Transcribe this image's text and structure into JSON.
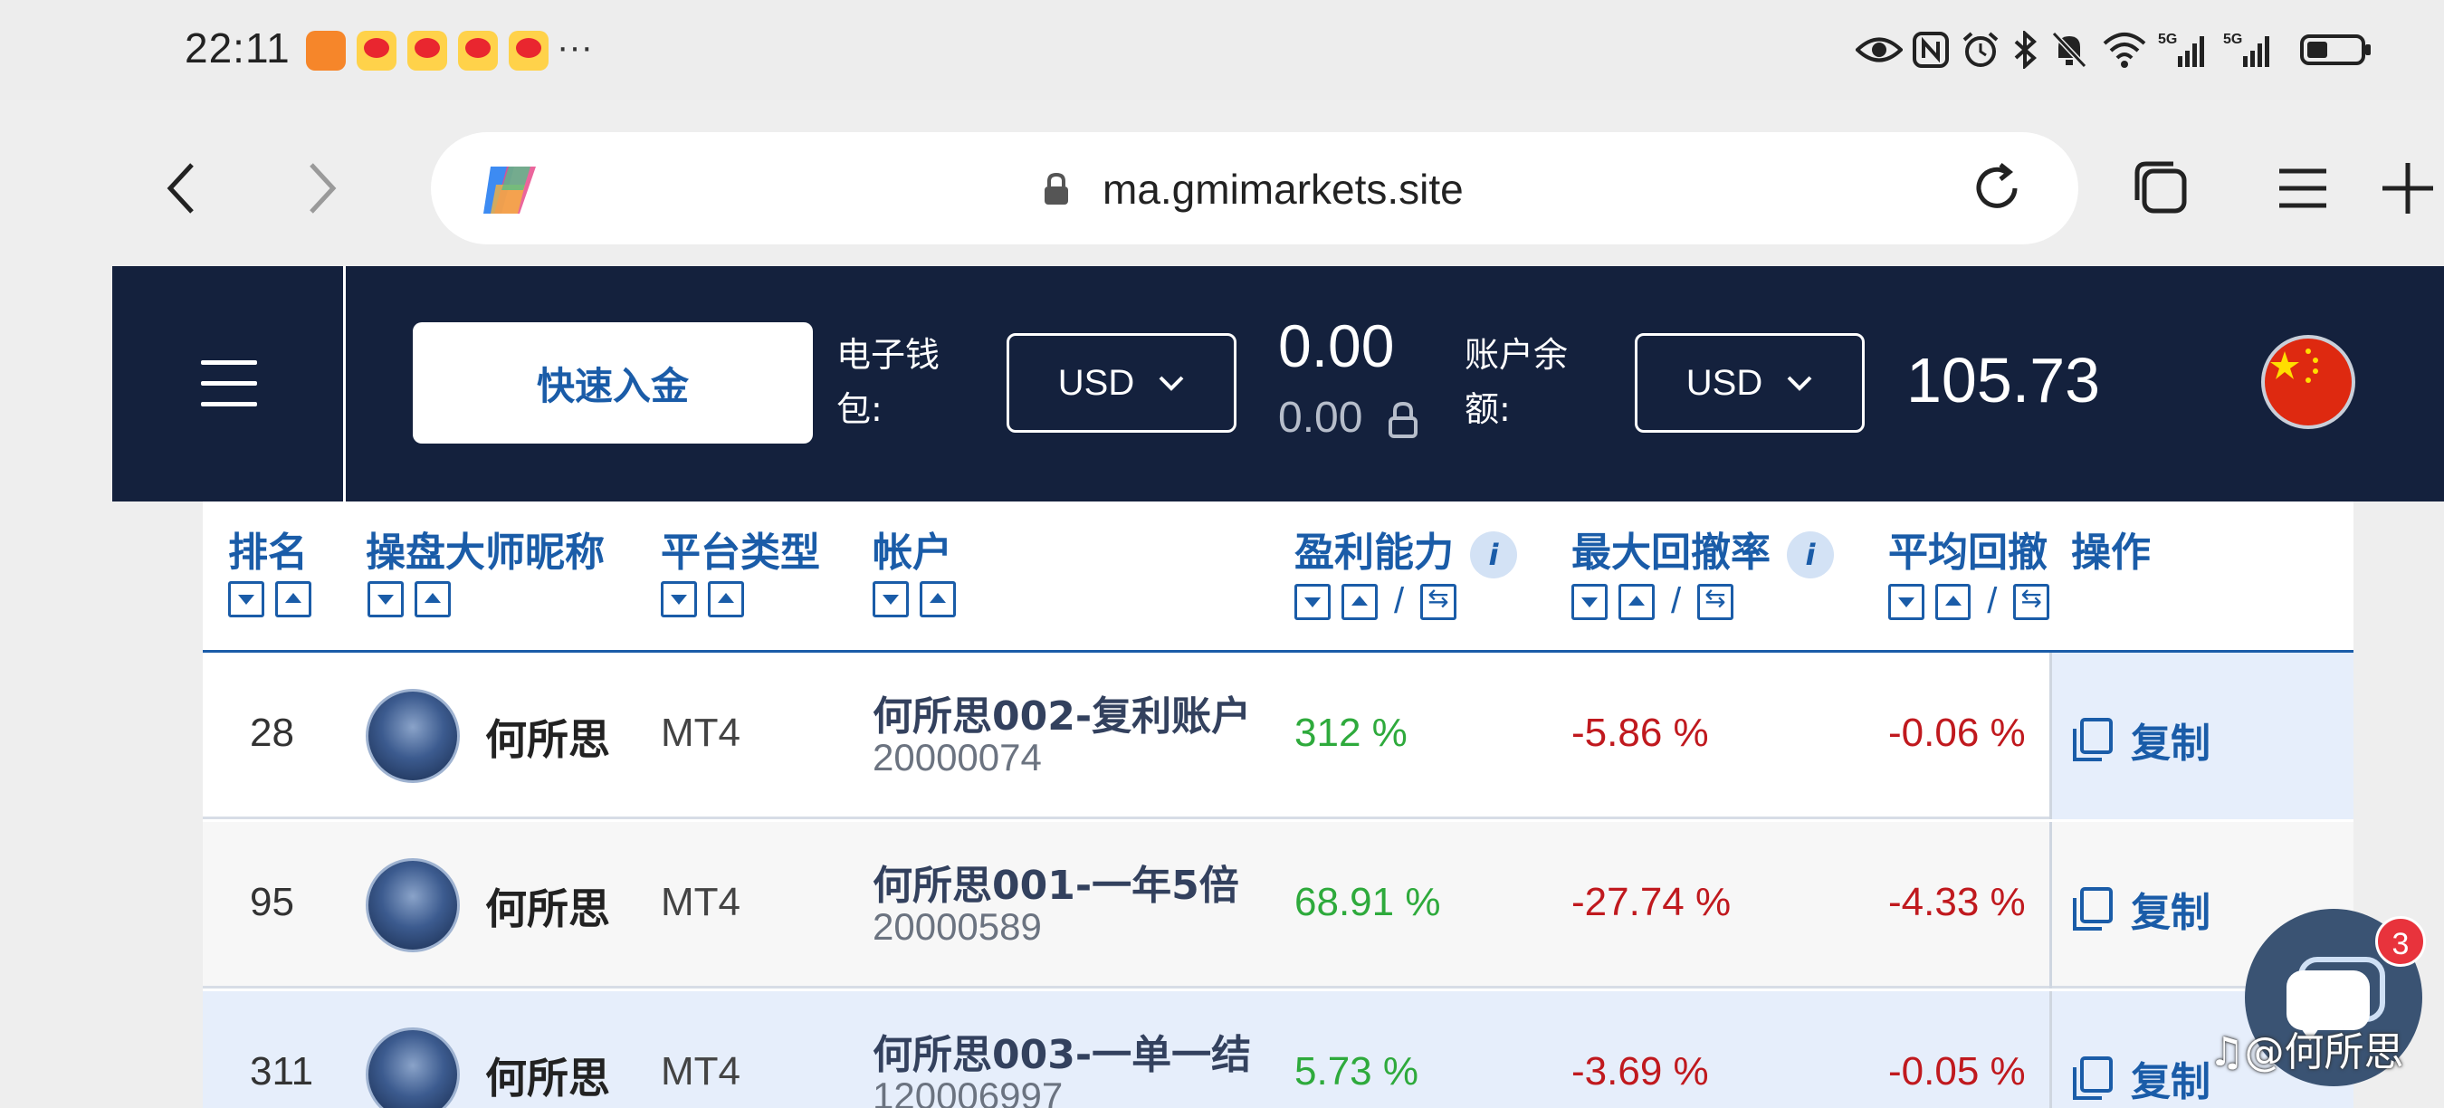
{
  "status_bar": {
    "time": "22:11",
    "more": "···"
  },
  "browser": {
    "url": "ma.gmimarkets.site"
  },
  "header": {
    "quick_deposit": "快速入金",
    "wallet_label": "电子钱包:",
    "wallet_currency": "USD",
    "wallet_value": "0.00",
    "wallet_locked": "0.00",
    "balance_label": "账户余额:",
    "balance_currency": "USD",
    "balance_value": "105.73"
  },
  "table": {
    "columns": [
      "排名",
      "操盘大师昵称",
      "平台类型",
      "帐户",
      "盈利能力",
      "最大回撤率",
      "平均回撤",
      "操作"
    ],
    "rows": [
      {
        "rank": "28",
        "nickname": "何所思",
        "platform": "MT4",
        "account_name": "何所思002-复利账户",
        "account_no": "20000074",
        "profit": "312 %",
        "max_drawdown": "-5.86 %",
        "avg_drawdown": "-0.06 %",
        "action": "复制"
      },
      {
        "rank": "95",
        "nickname": "何所思",
        "platform": "MT4",
        "account_name": "何所思001-一年5倍",
        "account_no": "20000589",
        "profit": "68.91 %",
        "max_drawdown": "-27.74 %",
        "avg_drawdown": "-4.33 %",
        "action": "复制"
      },
      {
        "rank": "311",
        "nickname": "何所思",
        "platform": "MT4",
        "account_name": "何所思003-一单一结",
        "account_no": "120006997",
        "profit": "5.73 %",
        "max_drawdown": "-3.69 %",
        "avg_drawdown": "-0.05 %",
        "action": "复制"
      }
    ]
  },
  "chat": {
    "badge": "3"
  },
  "watermark": "@何所思",
  "colors": {
    "header_bg": "#14213d",
    "link_blue": "#1a5ca8",
    "profit_green": "#2eaa3c",
    "loss_red": "#c0191e",
    "highlight_row": "#e6eefb"
  }
}
